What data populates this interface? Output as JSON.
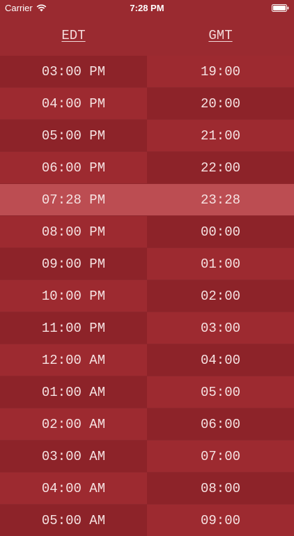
{
  "status_bar": {
    "carrier": "Carrier",
    "time": "7:28 PM"
  },
  "header": {
    "left_zone": "EDT",
    "right_zone": "GMT"
  },
  "rows": [
    {
      "left": "03:00 PM",
      "right": "19:00",
      "current": false
    },
    {
      "left": "04:00 PM",
      "right": "20:00",
      "current": false
    },
    {
      "left": "05:00 PM",
      "right": "21:00",
      "current": false
    },
    {
      "left": "06:00 PM",
      "right": "22:00",
      "current": false
    },
    {
      "left": "07:28 PM",
      "right": "23:28",
      "current": true
    },
    {
      "left": "08:00 PM",
      "right": "00:00",
      "current": false
    },
    {
      "left": "09:00 PM",
      "right": "01:00",
      "current": false
    },
    {
      "left": "10:00 PM",
      "right": "02:00",
      "current": false
    },
    {
      "left": "11:00 PM",
      "right": "03:00",
      "current": false
    },
    {
      "left": "12:00 AM",
      "right": "04:00",
      "current": false
    },
    {
      "left": "01:00 AM",
      "right": "05:00",
      "current": false
    },
    {
      "left": "02:00 AM",
      "right": "06:00",
      "current": false
    },
    {
      "left": "03:00 AM",
      "right": "07:00",
      "current": false
    },
    {
      "left": "04:00 AM",
      "right": "08:00",
      "current": false
    },
    {
      "left": "05:00 AM",
      "right": "09:00",
      "current": false
    }
  ],
  "colors": {
    "background": "#9a2a30",
    "row_dark": "#8d2329",
    "row_light": "#9d2a30",
    "row_current": "#bc4d52",
    "text": "#f6e2e2"
  },
  "icons": {
    "wifi": "wifi-icon",
    "battery": "battery-icon"
  }
}
